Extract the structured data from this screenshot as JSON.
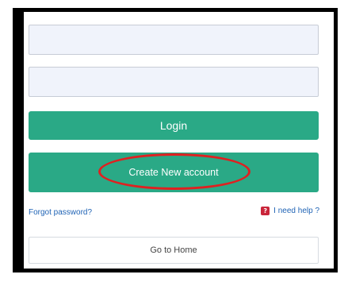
{
  "form": {
    "username_value": "",
    "password_value": ""
  },
  "buttons": {
    "login_label": "Login",
    "create_account_label": "Create New account",
    "home_label": "Go to Home"
  },
  "links": {
    "forgot_password": "Forgot password?",
    "need_help": "I need help ?"
  },
  "icons": {
    "help": "help-icon"
  },
  "colors": {
    "primary_button": "#2aa986",
    "highlight": "#e02020",
    "link": "#1f63b5",
    "help_icon": "#c9253a"
  }
}
